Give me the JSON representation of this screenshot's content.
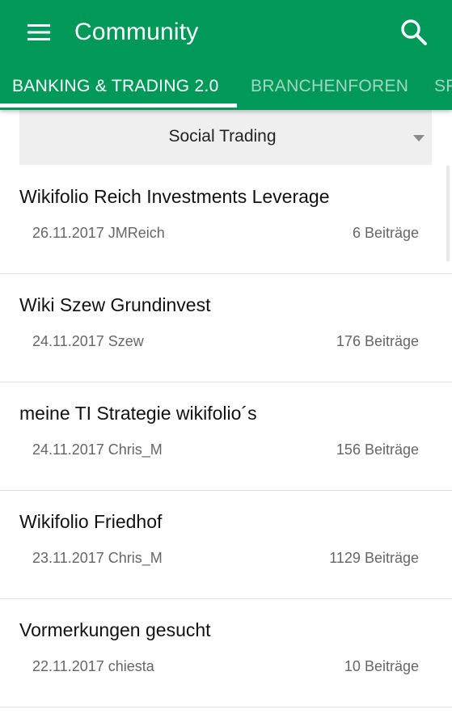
{
  "colors": {
    "primary": "#00995a",
    "text_on_primary": "#ffffff",
    "selector_bg": "#efefef",
    "meta_text": "#666666"
  },
  "app_bar": {
    "title": "Community",
    "menu_icon": "hamburger-menu-icon",
    "search_icon": "search-icon"
  },
  "tabs": [
    {
      "label": "BANKING & TRADING 2.0",
      "active": true
    },
    {
      "label": "BRANCHENFOREN",
      "active": false
    },
    {
      "label": "SP",
      "active": false
    }
  ],
  "selector": {
    "value": "Social Trading"
  },
  "threads": [
    {
      "title": "Wikifolio Reich Investments Leverage",
      "date": "26.11.2017",
      "author": "JMReich",
      "posts": "6 Beiträge"
    },
    {
      "title": "Wiki Szew Grundinvest",
      "date": "24.11.2017",
      "author": "Szew",
      "posts": "176 Beiträge"
    },
    {
      "title": "meine TI Strategie wikifolio´s",
      "date": "24.11.2017",
      "author": "Chris_M",
      "posts": "156 Beiträge"
    },
    {
      "title": "Wikifolio Friedhof",
      "date": "23.11.2017",
      "author": "Chris_M",
      "posts": "1129 Beiträge"
    },
    {
      "title": "Vormerkungen gesucht",
      "date": "22.11.2017",
      "author": "chiesta",
      "posts": "10 Beiträge"
    }
  ]
}
